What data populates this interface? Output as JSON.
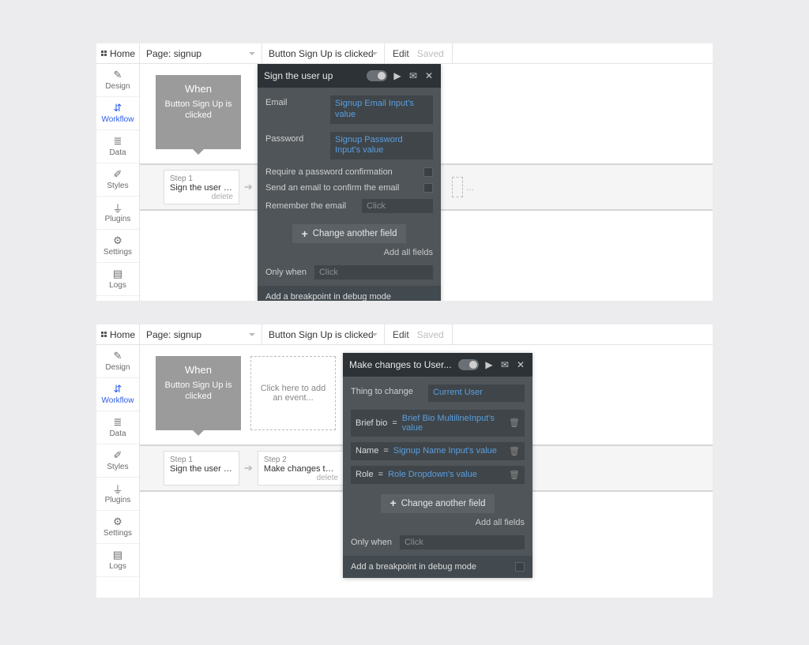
{
  "topbar": {
    "home": "Home",
    "page_dd": "Page: signup",
    "workflow_dd": "Button Sign Up is clicked",
    "edit": "Edit",
    "saved": "Saved"
  },
  "nav": {
    "design": "Design",
    "workflow": "Workflow",
    "data": "Data",
    "styles": "Styles",
    "plugins": "Plugins",
    "settings": "Settings",
    "logs": "Logs"
  },
  "when": {
    "title": "When",
    "subtitle": "Button Sign Up is clicked"
  },
  "add_event_placeholder": "Click here to add an event...",
  "steps": {
    "step1_label": "Step 1",
    "step1_title": "Sign the user up",
    "step2_label": "Step 2",
    "step2_title": "Make changes to User...",
    "delete": "delete",
    "ellipsis": "..."
  },
  "panel1": {
    "title": "Sign the user up",
    "email_k": "Email",
    "email_v": "Signup Email Input's value",
    "password_k": "Password",
    "password_v": "Signup Password Input's value",
    "require_confirm": "Require a password confirmation",
    "send_email": "Send an email to confirm the email",
    "remember": "Remember the email",
    "click_ph": "Click",
    "change_btn": "Change another field",
    "add_all": "Add all fields",
    "only_when": "Only when",
    "breakpoint": "Add a breakpoint in debug mode"
  },
  "panel2": {
    "title": "Make changes to User...",
    "thing_k": "Thing to change",
    "thing_v": "Current User",
    "f1_name": "Brief bio",
    "f1_expr": "Brief Bio MultilineInput's value",
    "f2_name": "Name",
    "f2_expr": "Signup Name Input's value",
    "f3_name": "Role",
    "f3_expr": "Role Dropdown's value",
    "change_btn": "Change another field",
    "add_all": "Add all fields",
    "only_when": "Only when",
    "click_ph": "Click",
    "breakpoint": "Add a breakpoint in debug mode"
  }
}
